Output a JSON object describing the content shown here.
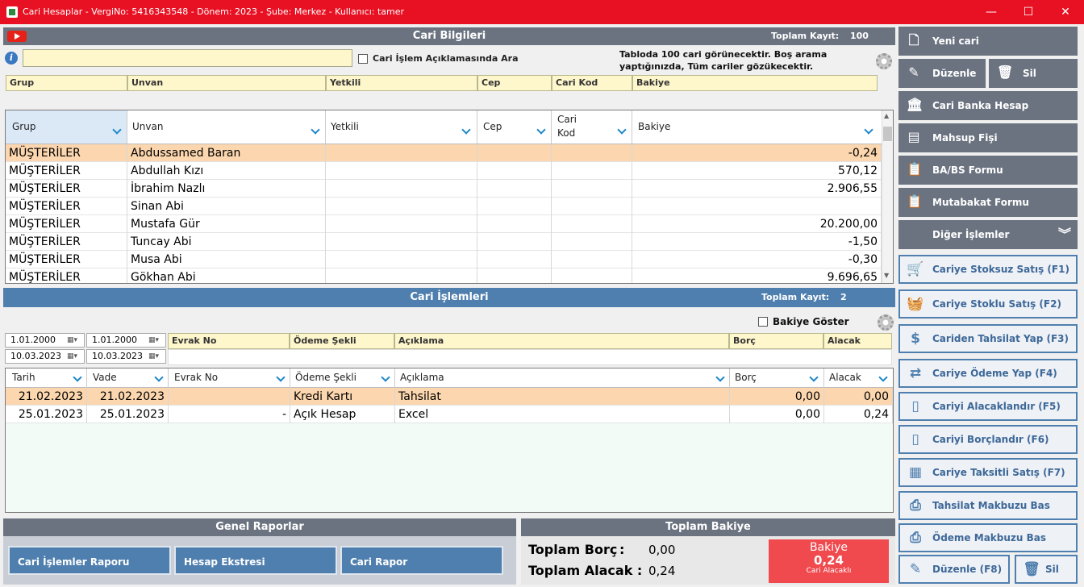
{
  "window": {
    "title": "Cari Hesaplar - VergiNo: 5416343548 - Dönem: 2023 - Şube: Merkez - Kullanıcı: tamer",
    "minimize": "—",
    "maximize": "☐",
    "close": "✕"
  },
  "cari": {
    "header": "Cari Bilgileri",
    "total_label": "Toplam Kayıt:",
    "total_value": "100",
    "search_value": "",
    "checkbox_label": "Cari İşlem Açıklamasında Ara",
    "info_text": "Tabloda 100 cari görünecektir. Boş arama yaptığınızda, Tüm cariler gözükecektir.",
    "filter_headers": [
      "Grup",
      "Unvan",
      "Yetkili",
      "Cep",
      "Cari Kod",
      "Bakiye"
    ],
    "columns": [
      "Grup",
      "Unvan",
      "Yetkili",
      "Cep",
      "Cari Kod",
      "Bakiye"
    ],
    "column_cari_kod_line1": "Cari",
    "column_cari_kod_line2": "Kod",
    "rows": [
      {
        "grup": "MÜŞTERİLER",
        "unvan": "Abdussamed Baran",
        "yetkili": "",
        "cep": "",
        "kod": "",
        "bakiye": "-0,24"
      },
      {
        "grup": "MÜŞTERİLER",
        "unvan": "Abdullah Kızı",
        "yetkili": "",
        "cep": "",
        "kod": "",
        "bakiye": "570,12"
      },
      {
        "grup": "MÜŞTERİLER",
        "unvan": "İbrahim Nazlı",
        "yetkili": "",
        "cep": "",
        "kod": "",
        "bakiye": "2.906,55"
      },
      {
        "grup": "MÜŞTERİLER",
        "unvan": "Sinan Abi",
        "yetkili": "",
        "cep": "",
        "kod": "",
        "bakiye": ""
      },
      {
        "grup": "MÜŞTERİLER",
        "unvan": "Mustafa Gür",
        "yetkili": "",
        "cep": "",
        "kod": "",
        "bakiye": "20.200,00"
      },
      {
        "grup": "MÜŞTERİLER",
        "unvan": "Tuncay Abi",
        "yetkili": "",
        "cep": "",
        "kod": "",
        "bakiye": "-1,50"
      },
      {
        "grup": "MÜŞTERİLER",
        "unvan": "Musa Abi",
        "yetkili": "",
        "cep": "",
        "kod": "",
        "bakiye": "-0,30"
      },
      {
        "grup": "MÜŞTERİLER",
        "unvan": "Gökhan Abi",
        "yetkili": "",
        "cep": "",
        "kod": "",
        "bakiye": "9.696,65"
      }
    ]
  },
  "islem": {
    "header": "Cari İşlemleri",
    "total_label": "Toplam Kayıt:",
    "total_value": "2",
    "bakiye_goster": "Bakiye Göster",
    "date_from1": "1.01.2000",
    "date_from2": "1.01.2000",
    "date_to1": "10.03.2023",
    "date_to2": "10.03.2023",
    "filter_headers": [
      "Evrak No",
      "Ödeme Şekli",
      "Açıklama",
      "Borç",
      "Alacak"
    ],
    "columns": [
      "Tarih",
      "Vade",
      "Evrak No",
      "Ödeme Şekli",
      "Açıklama",
      "Borç",
      "Alacak"
    ],
    "rows": [
      {
        "tarih": "21.02.2023",
        "vade": "21.02.2023",
        "evrak": "",
        "odeme": "Kredi Kartı",
        "aciklama": "Tahsilat",
        "borc": "0,00",
        "alacak": "0,00"
      },
      {
        "tarih": "25.01.2023",
        "vade": "25.01.2023",
        "evrak": "-",
        "odeme": "Açık Hesap",
        "aciklama": "Excel",
        "borc": "0,00",
        "alacak": "0,24"
      }
    ]
  },
  "raporlar": {
    "header": "Genel Raporlar",
    "buttons": [
      "Cari İşlemler Raporu",
      "Hesap Ekstresi",
      "Cari Rapor"
    ]
  },
  "bakiye": {
    "header": "Toplam Bakiye",
    "borc_label": "Toplam Borç",
    "borc_colon": ":",
    "borc_value": "0,00",
    "alacak_label": "Toplam Alacak :",
    "alacak_value": "0,24",
    "box_title": "Bakiye",
    "box_value": "0,24",
    "box_sub": "Cari Alacaklı",
    "box_color": "#f04a4f"
  },
  "sidebar": {
    "yeni_cari": "Yeni cari",
    "duzenle": "Düzenle",
    "sil": "Sil",
    "banka": "Cari Banka Hesap",
    "mahsup": "Mahsup Fişi",
    "babs": "BA/BS Formu",
    "mutabakat": "Mutabakat Formu",
    "diger": "Diğer İşlemler",
    "actions": [
      {
        "label": "Cariye Stoksuz Satış (F1)",
        "icon": "cart-icon"
      },
      {
        "label": "Cariye Stoklu Satış (F2)",
        "icon": "basket-icon"
      },
      {
        "label": "Cariden Tahsilat Yap (F3)",
        "icon": "money-hand-icon"
      },
      {
        "label": "Cariye Ödeme Yap (F4)",
        "icon": "payment-icon"
      },
      {
        "label": "Cariyi Alacaklandır (F5)",
        "icon": "receipt-icon"
      },
      {
        "label": "Cariyi Borçlandır (F6)",
        "icon": "receipt-icon"
      },
      {
        "label": "Cariye Taksitli Satış (F7)",
        "icon": "calendar-icon"
      },
      {
        "label": "Tahsilat Makbuzu Bas",
        "icon": "printer-icon"
      },
      {
        "label": "Ödeme Makbuzu Bas",
        "icon": "printer-icon"
      }
    ],
    "duzenle_f8": "Düzenle (F8)",
    "sil2": "Sil"
  },
  "colors": {
    "titlebar": "#e81123",
    "panel_gray": "#6b7380",
    "panel_blue": "#4f7fae",
    "selected_row": "#fbd6ae",
    "filter_yellow": "#fff7cc"
  }
}
